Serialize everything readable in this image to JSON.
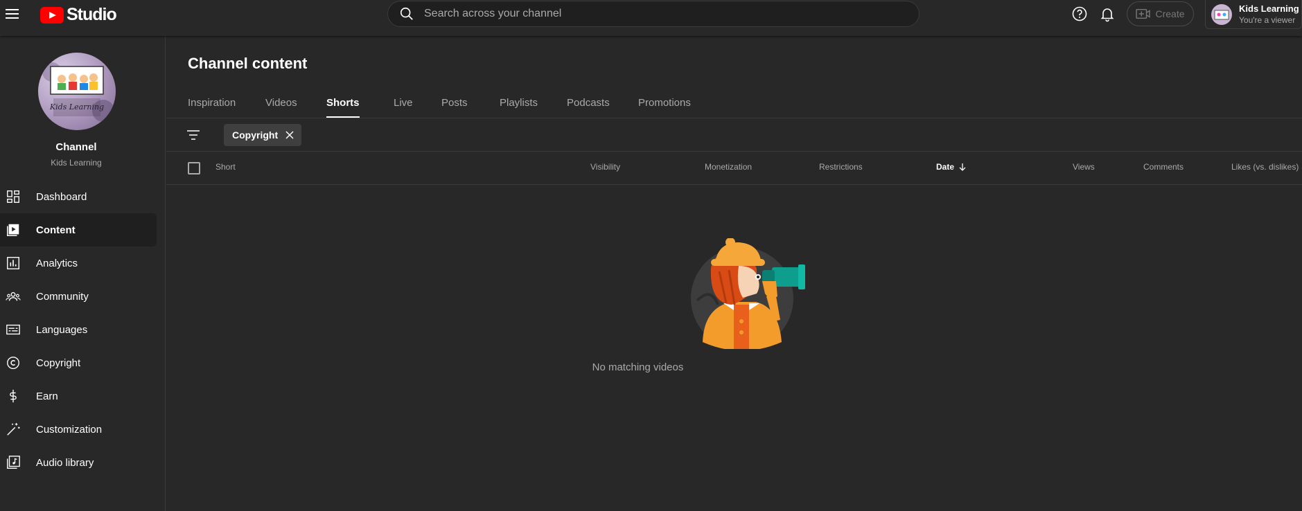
{
  "header": {
    "logo_text": "Studio",
    "search_placeholder": "Search across your channel",
    "create_label": "Create",
    "account_name": "Kids Learning",
    "account_role": "You're a viewer"
  },
  "sidebar": {
    "channel_title": "Channel",
    "channel_name": "Kids Learning",
    "avatar_text": "Kids Learning",
    "items": [
      {
        "label": "Dashboard",
        "icon": "dashboard-icon"
      },
      {
        "label": "Content",
        "icon": "content-icon",
        "active": true
      },
      {
        "label": "Analytics",
        "icon": "analytics-icon"
      },
      {
        "label": "Community",
        "icon": "community-icon"
      },
      {
        "label": "Languages",
        "icon": "languages-icon"
      },
      {
        "label": "Copyright",
        "icon": "copyright-icon"
      },
      {
        "label": "Earn",
        "icon": "earn-icon"
      },
      {
        "label": "Customization",
        "icon": "customization-icon"
      },
      {
        "label": "Audio library",
        "icon": "audio-library-icon"
      }
    ]
  },
  "main": {
    "title": "Channel content",
    "tabs": [
      {
        "label": "Inspiration"
      },
      {
        "label": "Videos"
      },
      {
        "label": "Shorts",
        "active": true
      },
      {
        "label": "Live"
      },
      {
        "label": "Posts"
      },
      {
        "label": "Playlists"
      },
      {
        "label": "Podcasts"
      },
      {
        "label": "Promotions"
      }
    ],
    "filter_chip": "Copyright",
    "columns": {
      "short": "Short",
      "visibility": "Visibility",
      "monetization": "Monetization",
      "restrictions": "Restrictions",
      "date": "Date",
      "views": "Views",
      "comments": "Comments",
      "likes": "Likes (vs. dislikes)"
    },
    "empty_message": "No matching videos"
  },
  "colors": {
    "background": "#282828",
    "brand_red": "#ff0000",
    "muted_text": "#aaaaaa"
  }
}
